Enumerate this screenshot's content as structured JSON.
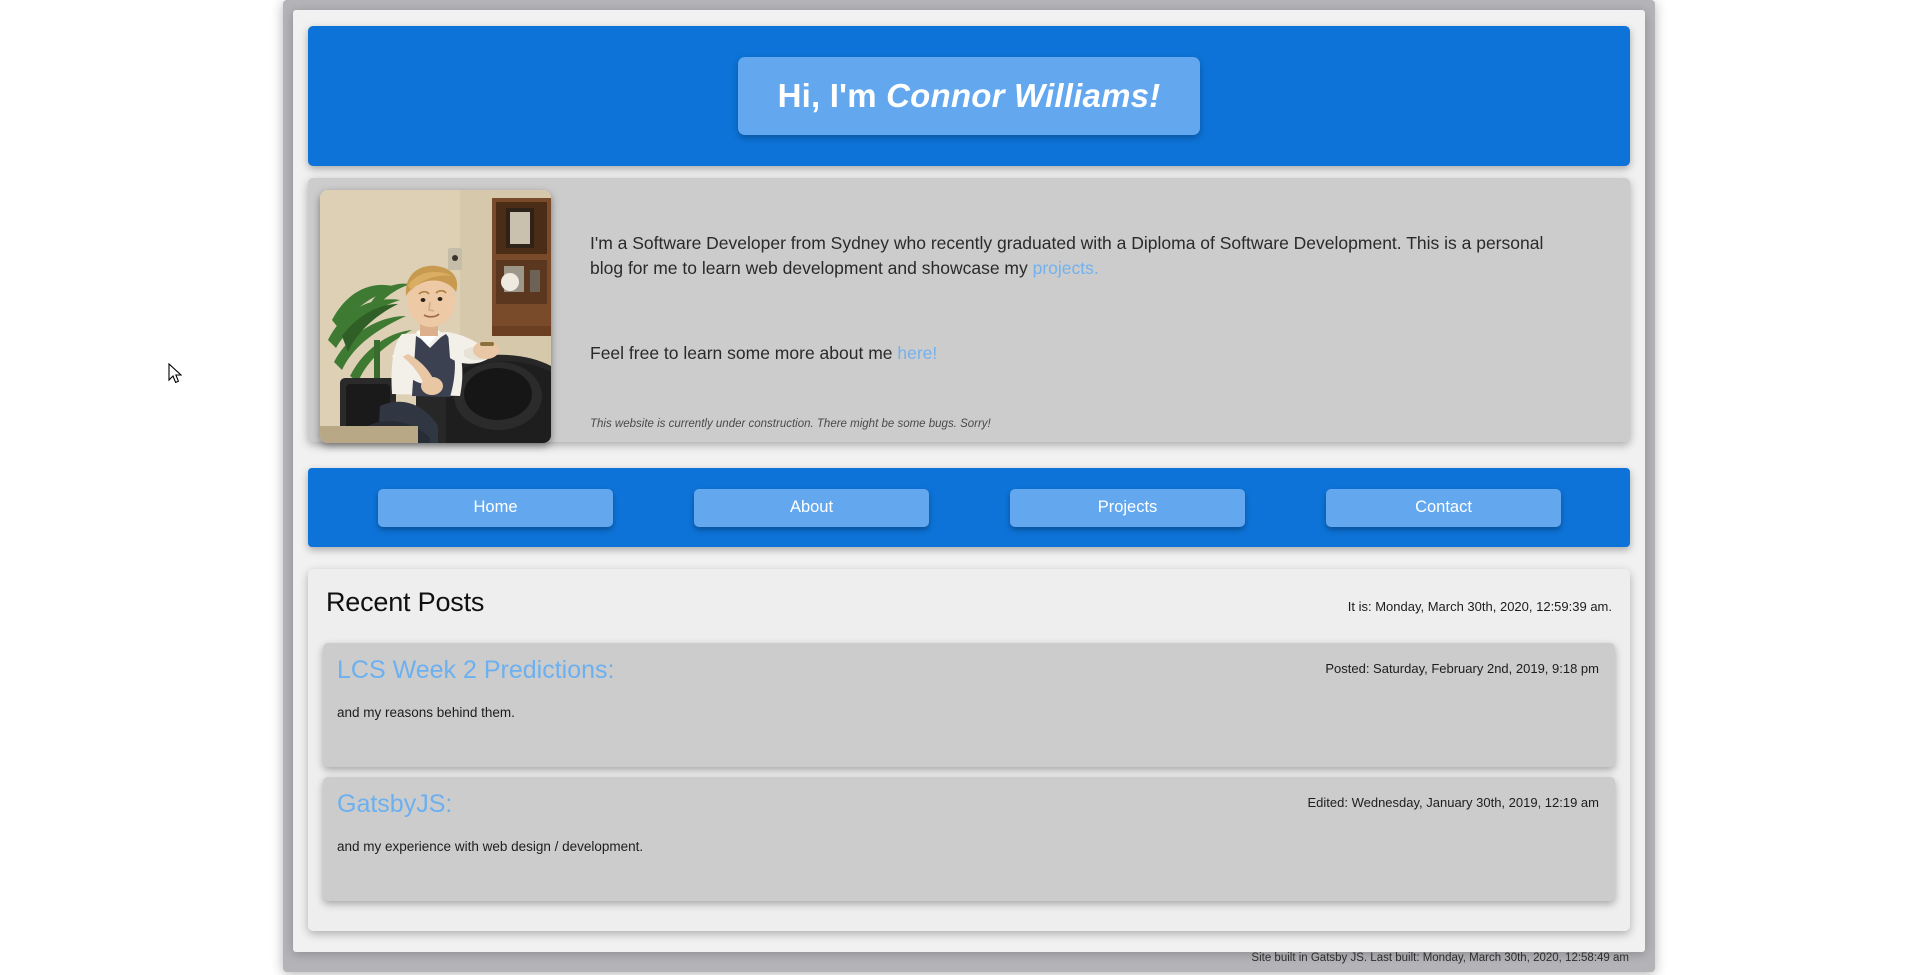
{
  "hero": {
    "greeting": "Hi, I'm ",
    "name": "Connor Williams!"
  },
  "intro": {
    "paragraph_1_before_link": "I'm a Software Developer from Sydney who recently graduated with a Diploma of Software Development. This is a personal blog for me to learn web development and showcase my ",
    "projects_link": "projects.",
    "paragraph_2_before_link": "Feel free to learn some more about me ",
    "here_link": "here!",
    "disclaimer": "This website is currently under construction. There might be some bugs. Sorry!",
    "portrait_alt": "portrait-photo"
  },
  "nav": {
    "items": [
      {
        "label": "Home"
      },
      {
        "label": "About"
      },
      {
        "label": "Projects"
      },
      {
        "label": "Contact"
      }
    ]
  },
  "posts_section": {
    "title": "Recent Posts",
    "clock": "It is: Monday, March 30th, 2020, 12:59:39 am.",
    "posts": [
      {
        "title": "LCS Week 2 Predictions:",
        "date": "Posted: Saturday, February 2nd, 2019, 9:18 pm",
        "subtitle": "and my reasons behind them."
      },
      {
        "title": "GatsbyJS:",
        "date": "Edited: Wednesday, January 30th, 2019, 12:19 am",
        "subtitle": "and my experience with web design / development."
      }
    ]
  },
  "footer": {
    "text": "Site built in Gatsby JS. Last built: Monday, March 30th, 2020, 12:58:49 am"
  },
  "colors": {
    "brand_blue": "#0d73d8",
    "accent_light_blue": "#63a8ef",
    "link_blue": "#73b2ee",
    "card_gray": "#cccccc",
    "panel_gray": "#eeeeee",
    "page_gray": "#b4b4b8"
  }
}
